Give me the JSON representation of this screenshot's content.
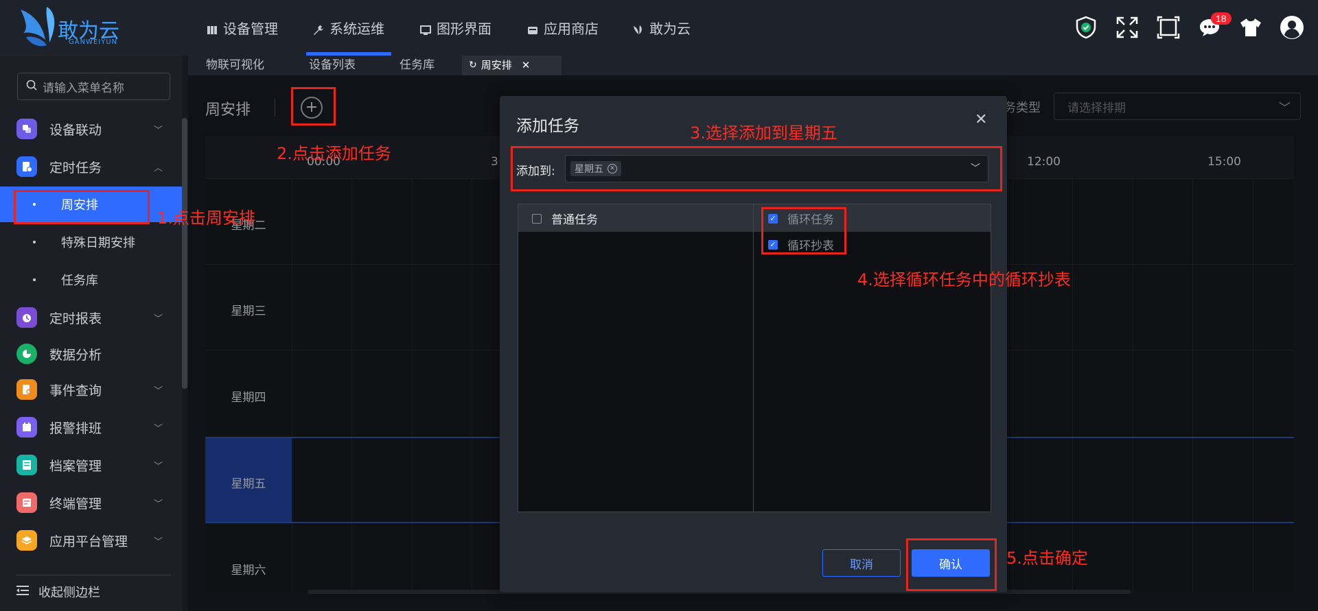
{
  "header": {
    "logo_text": "敢为云",
    "logo_subtext": "GANWEIYUN",
    "nav": [
      {
        "label": "设备管理",
        "icon": "device-icon"
      },
      {
        "label": "系统运维",
        "icon": "wrench-icon",
        "active": true
      },
      {
        "label": "图形界面",
        "icon": "monitor-icon"
      },
      {
        "label": "应用商店",
        "icon": "store-icon"
      },
      {
        "label": "敢为云",
        "icon": "butterfly-icon"
      }
    ],
    "notification_count": "18"
  },
  "tabs": [
    {
      "label": "物联可视化"
    },
    {
      "label": "设备列表"
    },
    {
      "label": "任务库"
    },
    {
      "label": "周安排",
      "active": true
    }
  ],
  "sidebar": {
    "search_placeholder": "请输入菜单名称",
    "items": [
      {
        "label": "设备联动",
        "color": "#6c5ce7"
      },
      {
        "label": "定时任务",
        "color": "#2f6bff",
        "expanded": true
      },
      {
        "label": "周安排",
        "sub": true,
        "active": true
      },
      {
        "label": "特殊日期安排",
        "sub": true
      },
      {
        "label": "任务库",
        "sub": true
      },
      {
        "label": "定时报表",
        "color": "#7b4dd6"
      },
      {
        "label": "数据分析",
        "color": "#19b067"
      },
      {
        "label": "事件查询",
        "color": "#f08c1d"
      },
      {
        "label": "报警排班",
        "color": "#7b5ff0"
      },
      {
        "label": "档案管理",
        "color": "#17b3a3"
      },
      {
        "label": "终端管理",
        "color": "#f06a6a"
      },
      {
        "label": "应用平台管理",
        "color": "#f5a623"
      }
    ],
    "collapse_label": "收起侧边栏"
  },
  "main": {
    "title": "周安排",
    "type_label": "务类型",
    "type_placeholder": "请选择排期",
    "times": [
      "00:00",
      "3:",
      "12:00",
      "15:00"
    ],
    "days": [
      "星期二",
      "星期三",
      "星期四",
      "星期五",
      "星期六"
    ],
    "highlighted_day": "星期五"
  },
  "dialog": {
    "title": "添加任务",
    "addto_label": "添加到:",
    "selected_tag": "星期五",
    "left_header": "普通任务",
    "right_items": [
      {
        "label": "循环任务",
        "checked": true
      },
      {
        "label": "循环抄表",
        "checked": true
      }
    ],
    "cancel_label": "取消",
    "confirm_label": "确认"
  },
  "annotations": [
    "1.点击周安排",
    "2.点击添加任务",
    "3.选择添加到星期五",
    "4.选择循环任务中的循环抄表",
    "5.点击确定"
  ],
  "colors": {
    "accent": "#2f6bff",
    "annotation": "#e8251d",
    "badge": "#f5222d"
  }
}
